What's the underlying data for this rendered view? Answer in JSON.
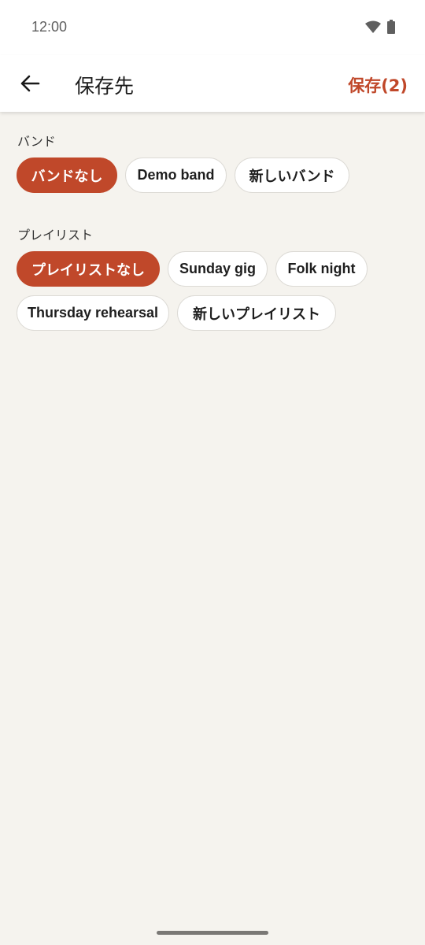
{
  "status_bar": {
    "time": "12:00"
  },
  "app_bar": {
    "title": "保存先",
    "save_label": "保存(2)"
  },
  "band_section": {
    "label": "バンド",
    "chips": [
      {
        "label": "バンドなし",
        "selected": true
      },
      {
        "label": "Demo band",
        "selected": false
      },
      {
        "label": "新しいバンド",
        "selected": false
      }
    ]
  },
  "playlist_section": {
    "label": "プレイリスト",
    "chips": [
      {
        "label": "プレイリストなし",
        "selected": true
      },
      {
        "label": "Sunday gig",
        "selected": false
      },
      {
        "label": "Folk night",
        "selected": false
      },
      {
        "label": "Thursday rehearsal",
        "selected": false
      },
      {
        "label": "新しいプレイリスト",
        "selected": false
      }
    ]
  },
  "colors": {
    "accent": "#c0482a",
    "background": "#f5f3ee",
    "surface": "#ffffff"
  },
  "icons": {
    "back": "arrow-left-icon",
    "wifi": "wifi-icon",
    "battery": "battery-icon"
  }
}
